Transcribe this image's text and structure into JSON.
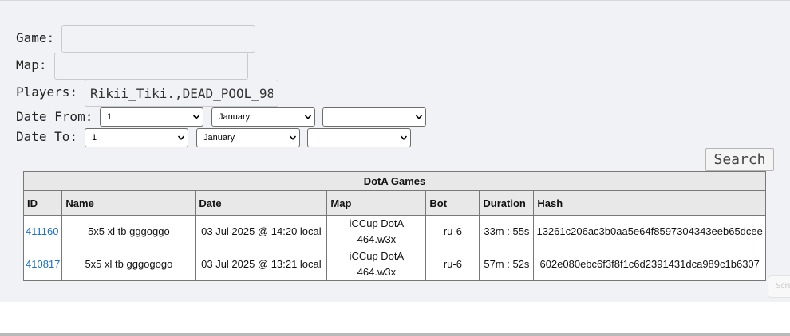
{
  "form": {
    "game_label": "Game:",
    "game_value": "",
    "map_label": "Map:",
    "map_value": "",
    "players_label": "Players:",
    "players_value": "Rikii_Tiki.,DEAD_POOL_98",
    "date_from_label": "Date From:",
    "date_from": {
      "day": "1",
      "month": "January",
      "year": ""
    },
    "date_to_label": "Date To:",
    "date_to": {
      "day": "1",
      "month": "January",
      "year": ""
    },
    "search_label": "Search"
  },
  "table": {
    "caption": "DotA Games",
    "columns": [
      "ID",
      "Name",
      "Date",
      "Map",
      "Bot",
      "Duration",
      "Hash"
    ],
    "rows": [
      {
        "id": "411160",
        "name": "5x5 xl tb gggoggo",
        "date": "03 Jul 2025 @ 14:20 local",
        "map_line1": "iCCup DotA",
        "map_line2": "464.w3x",
        "bot": "ru-6",
        "duration": "33m : 55s",
        "hash": "13261c206ac3b0aa5e64f8597304343eeb65dcee"
      },
      {
        "id": "410817",
        "name": "5x5 xl tb gggogogo",
        "date": "03 Jul 2025 @ 13:21 local",
        "map_line1": "iCCup DotA",
        "map_line2": "464.w3x",
        "bot": "ru-6",
        "duration": "57m : 52s",
        "hash": "602e080ebc6f3f8f1c6d2391431dca989c1b6307"
      }
    ]
  },
  "screen_tab_label": "Scre",
  "colors": {
    "link": "#1f6fc5",
    "panel_bg": "#f1f2f6",
    "header_bg": "#e8e8e8"
  }
}
